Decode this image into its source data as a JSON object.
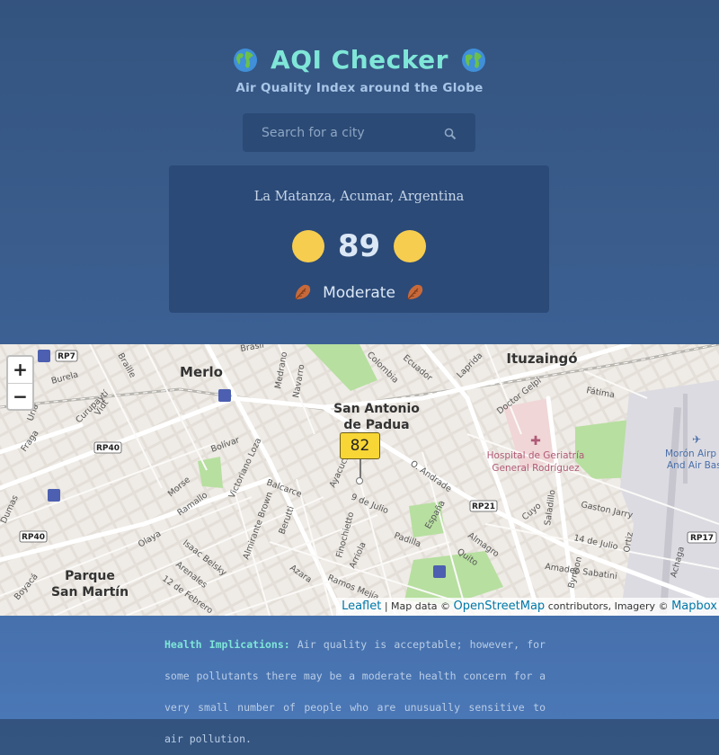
{
  "header": {
    "title": "AQI Checker",
    "subtitle": "Air Quality Index around the Globe"
  },
  "search": {
    "placeholder": "Search for a city"
  },
  "result": {
    "location": "La Matanza, Acumar, Argentina",
    "aqi": "89",
    "status": "Moderate",
    "status_color": "#f7cd4f"
  },
  "map": {
    "zoom_in_label": "+",
    "zoom_out_label": "−",
    "marker_value": "82",
    "place_labels": {
      "merlo": "Merlo",
      "ituzaingo": "Ituzaingó",
      "san_antonio_1": "San Antonio",
      "san_antonio_2": "de Padua",
      "parque_1": "Parque",
      "parque_2": "San Martín",
      "hospital_1": "Hospital de Geriatría",
      "hospital_2": "General Rodríguez",
      "airport_1": "Morón Airp",
      "airport_2": "And Air Bas"
    },
    "street_labels": {
      "colombia": "Colombia",
      "ecuador": "Ecuador",
      "laprida": "Laprida",
      "brasil": "Brasil",
      "braille": "Braille",
      "burela": "Burela",
      "medrano": "Medrano",
      "navarro": "Navarro",
      "curupayti": "Curupaytí",
      "vidt": "Vidt",
      "fatima": "Fátima",
      "doctor_gelpi": "Doctor Gelpi",
      "fraga": "Fraga",
      "bolivar": "Bolívar",
      "victoriano_loza": "Victoriano Loza",
      "balcarce": "Balcarce",
      "ayacucho": "Ayacucho",
      "o_andrade": "O. Andrade",
      "nueve_julio": "9 de Julio",
      "espana": "España",
      "gaston_jarry": "Gaston Jarry",
      "morse": "Morse",
      "ramallo": "Ramallo",
      "olaya": "Olaya",
      "almirante_brown": "Almirante Brown",
      "berutti": "Berutti",
      "finochietto": "Finochietto",
      "arriola": "Arriola",
      "padilla": "Padilla",
      "cuyo": "Cuyo",
      "saladillo": "Saladillo",
      "catorce_julio": "14 de Julio",
      "ortiz": "Ortiz",
      "almagro": "Almagro",
      "quito": "Quito",
      "isaac_belsky": "Isaac Belsky",
      "arenales": "Arenales",
      "doce_febrero": "12 de Febrero",
      "azara": "Azara",
      "ramos_mejia": "Ramos Mejía",
      "bynnon": "Bynnon",
      "achaga": "Achaga",
      "amadeo_sabatini": "Amadeo Sabatini",
      "boyaca": "Boyacá",
      "dumas": "Dumas",
      "uria": "Uría",
      "rp7": "RP7",
      "rp40a": "RP40",
      "rp40b": "RP40",
      "rp21": "RP21",
      "rp17": "RP17"
    },
    "attribution": {
      "leaflet": "Leaflet",
      "sep": " | Map data © ",
      "osm": "OpenStreetMap",
      "contrib": " contributors, Imagery © ",
      "mapbox": "Mapbox"
    }
  },
  "health": {
    "label": "Health Implications:",
    "text": " Air quality is acceptable; however, for some pollutants there may be a moderate health concern for a very small number of people who are unusually sensitive to air pollution."
  }
}
